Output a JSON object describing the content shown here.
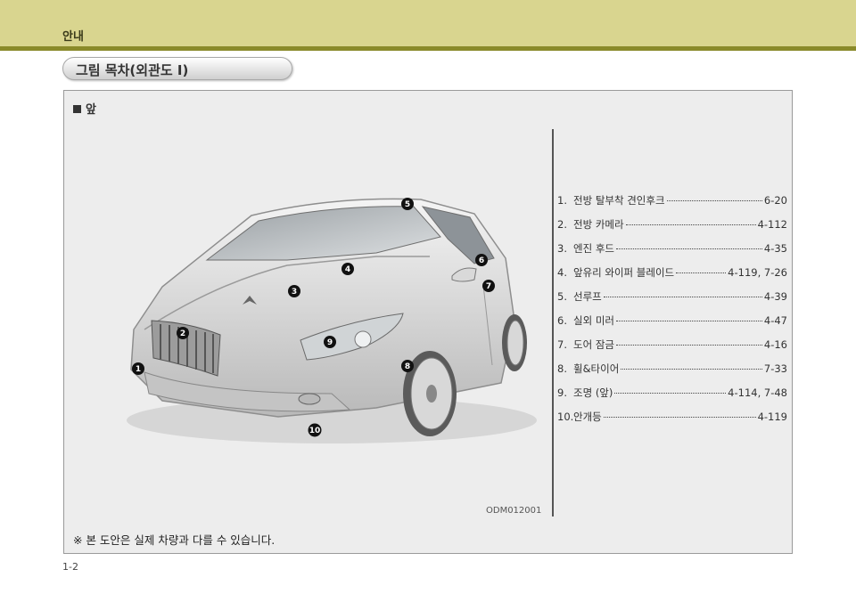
{
  "header": {
    "section": "안내"
  },
  "title": "그림 목차(외관도 I)",
  "panel": {
    "heading": "앞",
    "image_code": "ODM012001",
    "note": "※ 본 도안은 실제 차량과 다를 수 있습니다.",
    "callouts": [
      "1",
      "2",
      "3",
      "4",
      "5",
      "6",
      "7",
      "8",
      "9",
      "10"
    ],
    "toc": [
      {
        "num": "1.",
        "label": "전방 탈부착 견인후크",
        "page": "6-20"
      },
      {
        "num": "2.",
        "label": "전방 카메라",
        "page": "4-112"
      },
      {
        "num": "3.",
        "label": "엔진 후드",
        "page": "4-35"
      },
      {
        "num": "4.",
        "label": "앞유리 와이퍼 블레이드",
        "page": "4-119, 7-26"
      },
      {
        "num": "5.",
        "label": "선루프",
        "page": "4-39"
      },
      {
        "num": "6.",
        "label": "실외 미러",
        "page": "4-47"
      },
      {
        "num": "7.",
        "label": "도어 잠금",
        "page": "4-16"
      },
      {
        "num": "8.",
        "label": "휠&타이어",
        "page": "7-33"
      },
      {
        "num": "9.",
        "label": "조명 (앞)",
        "page": "4-114, 7-48"
      },
      {
        "num": "10.",
        "label": "안개등",
        "page": "4-119"
      }
    ]
  },
  "footer": {
    "page": "1-2"
  }
}
